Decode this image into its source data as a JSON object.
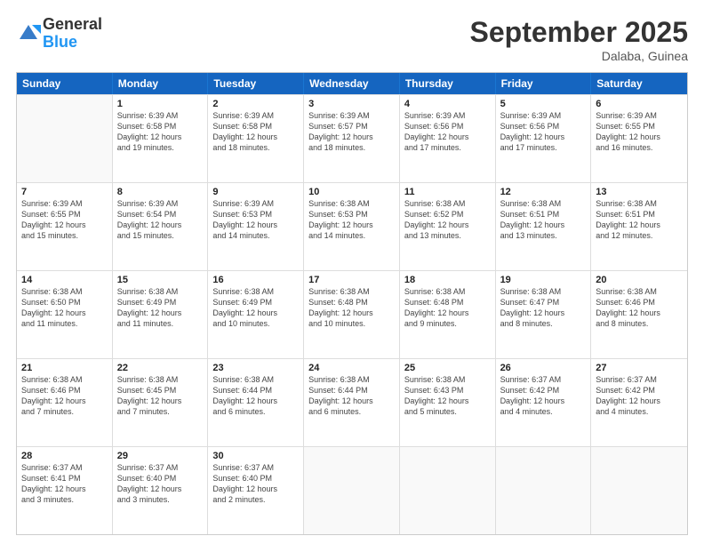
{
  "header": {
    "logo_general": "General",
    "logo_blue": "Blue",
    "month_title": "September 2025",
    "location": "Dalaba, Guinea"
  },
  "weekdays": [
    "Sunday",
    "Monday",
    "Tuesday",
    "Wednesday",
    "Thursday",
    "Friday",
    "Saturday"
  ],
  "rows": [
    [
      {
        "day": "",
        "empty": true
      },
      {
        "day": "1",
        "rise": "6:39 AM",
        "set": "6:58 PM",
        "daylight": "12 hours and 19 minutes."
      },
      {
        "day": "2",
        "rise": "6:39 AM",
        "set": "6:58 PM",
        "daylight": "12 hours and 18 minutes."
      },
      {
        "day": "3",
        "rise": "6:39 AM",
        "set": "6:57 PM",
        "daylight": "12 hours and 18 minutes."
      },
      {
        "day": "4",
        "rise": "6:39 AM",
        "set": "6:56 PM",
        "daylight": "12 hours and 17 minutes."
      },
      {
        "day": "5",
        "rise": "6:39 AM",
        "set": "6:56 PM",
        "daylight": "12 hours and 17 minutes."
      },
      {
        "day": "6",
        "rise": "6:39 AM",
        "set": "6:55 PM",
        "daylight": "12 hours and 16 minutes."
      }
    ],
    [
      {
        "day": "7",
        "rise": "6:39 AM",
        "set": "6:55 PM",
        "daylight": "12 hours and 15 minutes."
      },
      {
        "day": "8",
        "rise": "6:39 AM",
        "set": "6:54 PM",
        "daylight": "12 hours and 15 minutes."
      },
      {
        "day": "9",
        "rise": "6:39 AM",
        "set": "6:53 PM",
        "daylight": "12 hours and 14 minutes."
      },
      {
        "day": "10",
        "rise": "6:38 AM",
        "set": "6:53 PM",
        "daylight": "12 hours and 14 minutes."
      },
      {
        "day": "11",
        "rise": "6:38 AM",
        "set": "6:52 PM",
        "daylight": "12 hours and 13 minutes."
      },
      {
        "day": "12",
        "rise": "6:38 AM",
        "set": "6:51 PM",
        "daylight": "12 hours and 13 minutes."
      },
      {
        "day": "13",
        "rise": "6:38 AM",
        "set": "6:51 PM",
        "daylight": "12 hours and 12 minutes."
      }
    ],
    [
      {
        "day": "14",
        "rise": "6:38 AM",
        "set": "6:50 PM",
        "daylight": "12 hours and 11 minutes."
      },
      {
        "day": "15",
        "rise": "6:38 AM",
        "set": "6:49 PM",
        "daylight": "12 hours and 11 minutes."
      },
      {
        "day": "16",
        "rise": "6:38 AM",
        "set": "6:49 PM",
        "daylight": "12 hours and 10 minutes."
      },
      {
        "day": "17",
        "rise": "6:38 AM",
        "set": "6:48 PM",
        "daylight": "12 hours and 10 minutes."
      },
      {
        "day": "18",
        "rise": "6:38 AM",
        "set": "6:48 PM",
        "daylight": "12 hours and 9 minutes."
      },
      {
        "day": "19",
        "rise": "6:38 AM",
        "set": "6:47 PM",
        "daylight": "12 hours and 8 minutes."
      },
      {
        "day": "20",
        "rise": "6:38 AM",
        "set": "6:46 PM",
        "daylight": "12 hours and 8 minutes."
      }
    ],
    [
      {
        "day": "21",
        "rise": "6:38 AM",
        "set": "6:46 PM",
        "daylight": "12 hours and 7 minutes."
      },
      {
        "day": "22",
        "rise": "6:38 AM",
        "set": "6:45 PM",
        "daylight": "12 hours and 7 minutes."
      },
      {
        "day": "23",
        "rise": "6:38 AM",
        "set": "6:44 PM",
        "daylight": "12 hours and 6 minutes."
      },
      {
        "day": "24",
        "rise": "6:38 AM",
        "set": "6:44 PM",
        "daylight": "12 hours and 6 minutes."
      },
      {
        "day": "25",
        "rise": "6:38 AM",
        "set": "6:43 PM",
        "daylight": "12 hours and 5 minutes."
      },
      {
        "day": "26",
        "rise": "6:37 AM",
        "set": "6:42 PM",
        "daylight": "12 hours and 4 minutes."
      },
      {
        "day": "27",
        "rise": "6:37 AM",
        "set": "6:42 PM",
        "daylight": "12 hours and 4 minutes."
      }
    ],
    [
      {
        "day": "28",
        "rise": "6:37 AM",
        "set": "6:41 PM",
        "daylight": "12 hours and 3 minutes."
      },
      {
        "day": "29",
        "rise": "6:37 AM",
        "set": "6:40 PM",
        "daylight": "12 hours and 3 minutes."
      },
      {
        "day": "30",
        "rise": "6:37 AM",
        "set": "6:40 PM",
        "daylight": "12 hours and 2 minutes."
      },
      {
        "day": "",
        "empty": true
      },
      {
        "day": "",
        "empty": true
      },
      {
        "day": "",
        "empty": true
      },
      {
        "day": "",
        "empty": true
      }
    ]
  ]
}
